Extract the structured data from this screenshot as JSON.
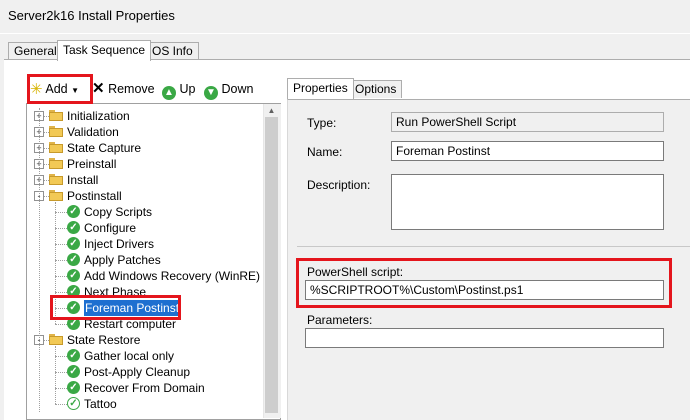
{
  "window": {
    "title": "Server2k16 Install Properties"
  },
  "tabs": [
    "General",
    "Task Sequence",
    "OS Info"
  ],
  "toolbar": {
    "add": "Add",
    "remove": "Remove",
    "up": "Up",
    "down": "Down"
  },
  "tree": {
    "items": [
      {
        "label": "Initialization",
        "icon": "folder-icon",
        "level": 0,
        "expander": "+"
      },
      {
        "label": "Validation",
        "icon": "folder-icon",
        "level": 0,
        "expander": "+"
      },
      {
        "label": "State Capture",
        "icon": "folder-icon",
        "level": 0,
        "expander": "+"
      },
      {
        "label": "Preinstall",
        "icon": "folder-icon",
        "level": 0,
        "expander": "+"
      },
      {
        "label": "Install",
        "icon": "folder-icon",
        "level": 0,
        "expander": "+"
      },
      {
        "label": "Postinstall",
        "icon": "folder-icon",
        "level": 0,
        "expander": "-"
      },
      {
        "label": "Copy Scripts",
        "icon": "check-icon",
        "level": 1
      },
      {
        "label": "Configure",
        "icon": "check-icon",
        "level": 1
      },
      {
        "label": "Inject Drivers",
        "icon": "check-icon",
        "level": 1
      },
      {
        "label": "Apply Patches",
        "icon": "check-icon",
        "level": 1
      },
      {
        "label": "Add Windows Recovery (WinRE)",
        "icon": "check-icon",
        "level": 1
      },
      {
        "label": "Next Phase",
        "icon": "check-icon",
        "level": 1
      },
      {
        "label": "Foreman Postinst",
        "icon": "check-icon",
        "level": 1,
        "selected": true
      },
      {
        "label": "Restart computer",
        "icon": "check-icon",
        "level": 1
      },
      {
        "label": "State Restore",
        "icon": "folder-icon",
        "level": 0,
        "expander": "-"
      },
      {
        "label": "Gather local only",
        "icon": "check-icon",
        "level": 1
      },
      {
        "label": "Post-Apply Cleanup",
        "icon": "check-icon",
        "level": 1
      },
      {
        "label": "Recover From Domain",
        "icon": "check-icon",
        "level": 1
      },
      {
        "label": "Tattoo",
        "icon": "check-empty-icon",
        "level": 1
      }
    ]
  },
  "right_tabs": [
    "Properties",
    "Options"
  ],
  "properties": {
    "type_label": "Type:",
    "type_value": "Run PowerShell Script",
    "name_label": "Name:",
    "name_value": "Foreman Postinst",
    "description_label": "Description:",
    "description_value": "",
    "script_label": "PowerShell script:",
    "script_value": "%SCRIPTROOT%\\Custom\\Postinst.ps1",
    "parameters_label": "Parameters:",
    "parameters_value": ""
  },
  "colors": {
    "highlight": "#e4151c",
    "selection": "#1e6fd0",
    "check": "#3aa845"
  }
}
